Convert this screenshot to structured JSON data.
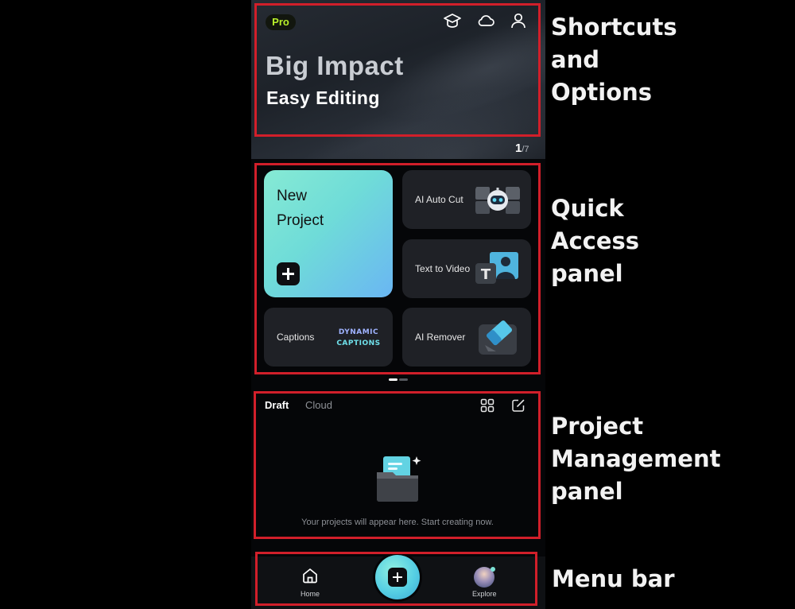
{
  "banner": {
    "pro_badge": "Pro",
    "title": "Big Impact",
    "subtitle": "Easy Editing",
    "pager_current": "1",
    "pager_total": "/7",
    "icons": [
      "graduation-cap-icon",
      "cloud-icon",
      "user-icon"
    ]
  },
  "quick_access": {
    "new_project_line1": "New",
    "new_project_line2": "Project",
    "ai_auto_cut": "AI Auto Cut",
    "text_to_video": "Text to Video",
    "captions": "Captions",
    "captions_thumb_line1": "DYNAMIC",
    "captions_thumb_line2": "CAPTIONS",
    "ai_remover": "AI Remover"
  },
  "projects": {
    "tabs": [
      "Draft",
      "Cloud"
    ],
    "active_tab": "Draft",
    "empty_message": "Your projects will appear here. Start creating now.",
    "icons": [
      "grid-view-icon",
      "edit-icon"
    ]
  },
  "menu_bar": {
    "home_label": "Home",
    "explore_label": "Explore"
  },
  "annotations": {
    "shortcuts": "Shortcuts\nand\nOptions",
    "quick_access": "Quick\nAccess\npanel",
    "project_management": "Project\nManagement\npanel",
    "menu_bar": "Menu bar"
  },
  "colors": {
    "annotation_red": "#d11f2a",
    "pro_green": "#b8f02a",
    "accent_teal": "#6fdcd8",
    "tile_bg": "#1f2126"
  }
}
